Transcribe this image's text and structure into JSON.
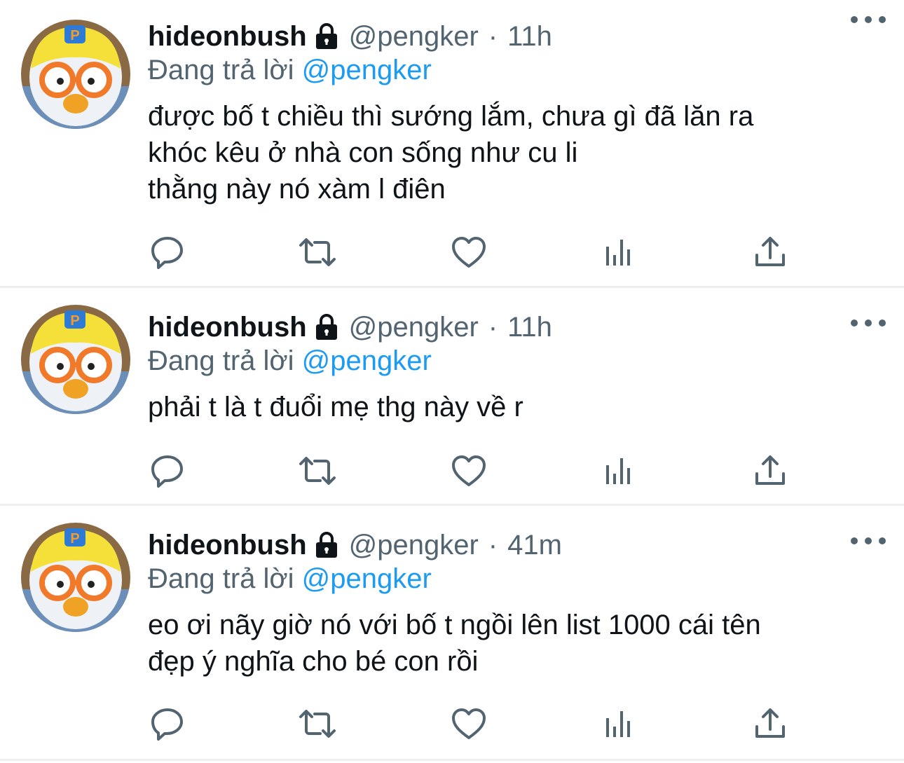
{
  "tweets": [
    {
      "name": "hideonbush",
      "handle": "@pengker",
      "separator": "·",
      "time": "11h",
      "reply_prefix": "Đang trả lời ",
      "reply_mention": "@pengker",
      "lines": [
        "được bố t chiều thì sướng lắm, chưa gì đã lăn ra",
        "khóc kêu ở nhà con sống như cu li",
        "thằng này nó xàm l điên"
      ]
    },
    {
      "name": "hideonbush",
      "handle": "@pengker",
      "separator": "·",
      "time": "11h",
      "reply_prefix": "Đang trả lời ",
      "reply_mention": "@pengker",
      "lines": [
        "phải t là t đuổi mẹ thg này về r"
      ]
    },
    {
      "name": "hideonbush",
      "handle": "@pengker",
      "separator": "·",
      "time": "41m",
      "reply_prefix": "Đang trả lời ",
      "reply_mention": "@pengker",
      "lines": [
        "eo ơi nãy giờ nó với bố t ngồi lên list 1000 cái tên",
        "đẹp ý nghĩa cho bé con rồi"
      ]
    }
  ],
  "icons": {
    "lock": "lock-icon",
    "more": "more-icon",
    "reply": "reply-icon",
    "retweet": "retweet-icon",
    "like": "heart-icon",
    "analytics": "analytics-icon",
    "share": "share-icon"
  },
  "colors": {
    "text": "#0f1419",
    "secondary": "#536471",
    "mention": "#1d9bf0",
    "divider": "#eceef0"
  }
}
